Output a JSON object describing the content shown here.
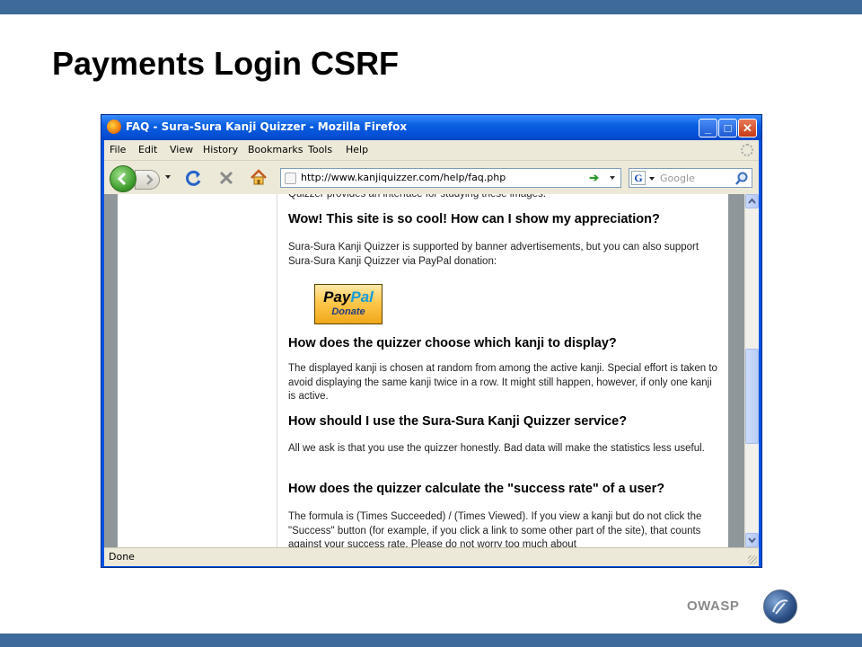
{
  "slide": {
    "title": "Payments Login CSRF",
    "footer_brand": "OWASP"
  },
  "browser": {
    "window_title": "FAQ - Sura-Sura Kanji Quizzer - Mozilla Firefox",
    "menu": [
      "File",
      "Edit",
      "View",
      "History",
      "Bookmarks",
      "Tools",
      "Help"
    ],
    "url": "http://www.kanjiquizzer.com/help/faq.php",
    "search_placeholder": "Google",
    "status": "Done"
  },
  "page": {
    "top_partial": "Quizzer provides an interface for studying these images.",
    "h1": "Wow! This site is so cool! How can I show my appreciation?",
    "p1": "Sura-Sura Kanji Quizzer is supported by banner advertisements, but you can also support Sura-Sura Kanji Quizzer via PayPal donation:",
    "paypal": {
      "pay": "Pay",
      "pal": "Pal",
      "donate": "Donate"
    },
    "h2": "How does the quizzer choose which kanji to display?",
    "p2": "The displayed kanji is chosen at random from among the active kanji. Special effort is taken to avoid displaying the same kanji twice in a row. It might still happen, however, if only one kanji is active.",
    "h3": "How should I use the Sura-Sura Kanji Quizzer service?",
    "p3": "All we ask is that you use the quizzer honestly. Bad data will make the statistics less useful.",
    "h4": "How does the quizzer calculate the \"success rate\" of a user?",
    "p4": "The formula is (Times Succeeded) / (Times Viewed). If you view a kanji but do not click the \"Success\" button (for example, if you click a link to some other part of the site), that counts against your success rate. Please do not worry too much about"
  }
}
